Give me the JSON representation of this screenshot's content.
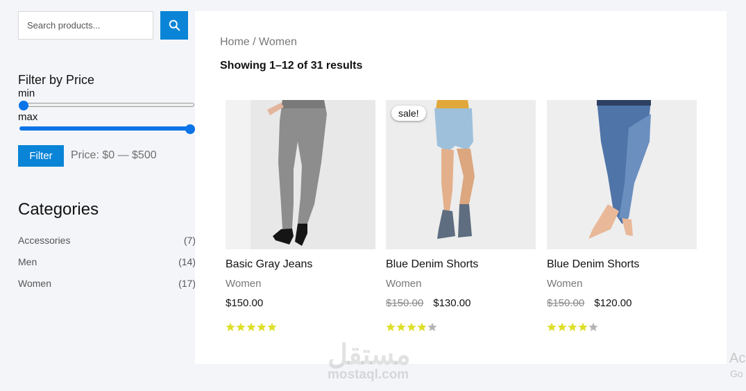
{
  "search": {
    "placeholder": "Search products...",
    "icon": "search-icon"
  },
  "price_filter": {
    "title": "Filter by Price",
    "min_label": "min",
    "max_label": "max",
    "min_value_fraction": 0,
    "max_value_fraction": 1,
    "button_label": "Filter",
    "range_text": "Price: $0 — $500"
  },
  "categories": {
    "title": "Categories",
    "items": [
      {
        "label": "Accessories",
        "count": "(7)"
      },
      {
        "label": "Men",
        "count": "(14)"
      },
      {
        "label": "Women",
        "count": "(17)"
      }
    ]
  },
  "breadcrumb": {
    "home": "Home",
    "separator": " / ",
    "current": "Women"
  },
  "result_count": "Showing 1–12 of 31 results",
  "products": [
    {
      "title": "Basic Gray Jeans",
      "category": "Women",
      "old_price": "",
      "price": "$150.00",
      "rating": 5,
      "sale": "",
      "image": "gray-jeans-image"
    },
    {
      "title": "Blue Denim Shorts",
      "category": "Women",
      "old_price": "$150.00",
      "price": "$130.00",
      "rating": 4,
      "sale": "sale!",
      "image": "denim-shorts-image"
    },
    {
      "title": "Blue Denim Shorts",
      "category": "Women",
      "old_price": "$150.00",
      "price": "$120.00",
      "rating": 4,
      "sale": "",
      "image": "blue-jeans-image"
    }
  ],
  "colors": {
    "accent": "#0a84d6",
    "star_filled": "#dddf2b",
    "star_empty": "#b5b5b5"
  },
  "watermark": {
    "arabic": "مستقل",
    "latin": "mostaql.com"
  },
  "os_overlay": {
    "line1": "Ac",
    "line2": "Go"
  }
}
